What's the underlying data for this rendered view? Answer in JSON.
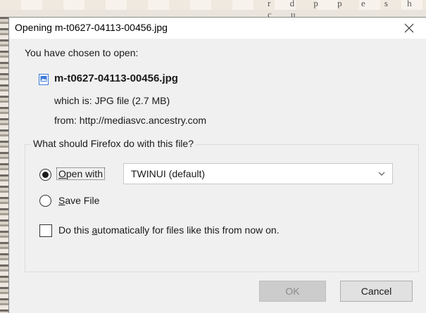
{
  "window": {
    "title": "Opening m-t0627-04113-00456.jpg"
  },
  "background": {
    "doc_fragment_text": "r d p p e s h c u"
  },
  "dialog": {
    "intro": "You have chosen to open:",
    "file": {
      "name": "m-t0627-04113-00456.jpg",
      "type_line": "which is:  JPG file (2.7 MB)",
      "source_line": "from:  http://mediasvc.ancestry.com",
      "icon": "image-file-icon"
    },
    "question": "What should Firefox do with this file?",
    "options": {
      "open_with": {
        "label_prefix": "",
        "label_accel": "O",
        "label_rest": "pen with",
        "selected": true
      },
      "save_file": {
        "label_accel": "S",
        "label_rest": "ave File",
        "selected": false
      }
    },
    "app_select": {
      "value": "TWINUI (default)"
    },
    "auto_checkbox": {
      "label_pre": "Do this ",
      "label_accel": "a",
      "label_rest": "utomatically for files like this from now on.",
      "checked": false
    },
    "buttons": {
      "ok": "OK",
      "cancel": "Cancel"
    }
  },
  "icons": {
    "close": "close-icon",
    "chevron": "chevron-down-icon"
  }
}
